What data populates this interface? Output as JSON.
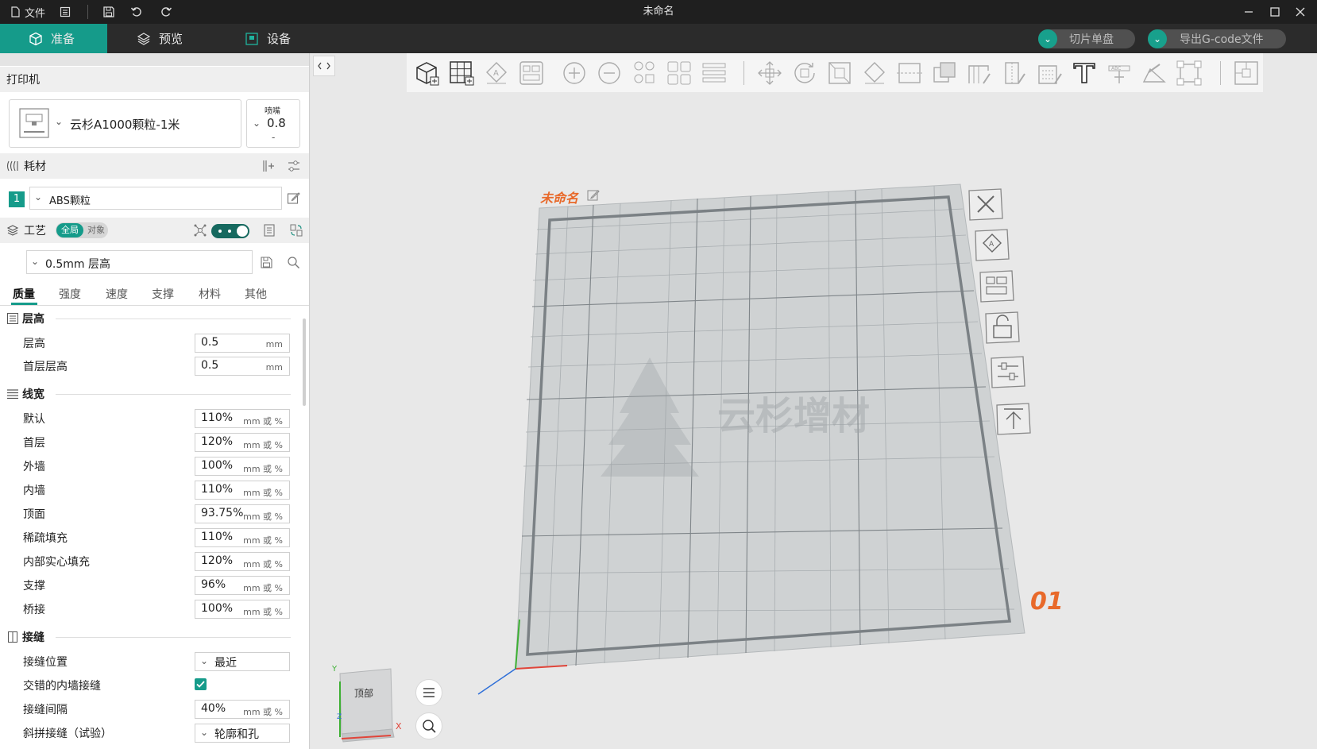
{
  "titlebar": {
    "file_menu": "文件",
    "window_title": "未命名"
  },
  "tabs": {
    "prepare": "准备",
    "preview": "预览",
    "device": "设备",
    "slice_plate": "切片单盘",
    "export_gcode": "导出G-code文件"
  },
  "printer": {
    "section_title": "打印机",
    "name": "云杉A1000颗粒-1米",
    "nozzle_label": "喷嘴",
    "nozzle_value": "0.8",
    "nozzle_sub": "-"
  },
  "filament": {
    "section_title": "耗材",
    "index": "1",
    "name": "ABS颗粒"
  },
  "process": {
    "section_title": "工艺",
    "toggle_global": "全局",
    "toggle_object": "对象",
    "preset": "0.5mm 层高",
    "tabs": [
      "质量",
      "强度",
      "速度",
      "支撑",
      "材料",
      "其他"
    ]
  },
  "groups": {
    "layer_height": "层高",
    "line_width": "线宽",
    "seam": "接缝"
  },
  "fields": {
    "layer_height": {
      "label": "层高",
      "value": "0.5",
      "unit": "mm"
    },
    "first_layer_height": {
      "label": "首层层高",
      "value": "0.5",
      "unit": "mm"
    },
    "default_width": {
      "label": "默认",
      "value": "110%",
      "unit": "mm 或 %"
    },
    "first_layer_width": {
      "label": "首层",
      "value": "120%",
      "unit": "mm 或 %"
    },
    "outer_wall": {
      "label": "外墙",
      "value": "100%",
      "unit": "mm 或 %"
    },
    "inner_wall": {
      "label": "内墙",
      "value": "110%",
      "unit": "mm 或 %"
    },
    "top_surface": {
      "label": "顶面",
      "value": "93.75%",
      "unit": "mm 或 %"
    },
    "sparse_infill": {
      "label": "稀疏填充",
      "value": "110%",
      "unit": "mm 或 %"
    },
    "internal_solid_infill": {
      "label": "内部实心填充",
      "value": "120%",
      "unit": "mm 或 %"
    },
    "support": {
      "label": "支撑",
      "value": "96%",
      "unit": "mm 或 %"
    },
    "bridge": {
      "label": "桥接",
      "value": "100%",
      "unit": "mm 或 %"
    },
    "seam_position": {
      "label": "接缝位置",
      "value": "最近"
    },
    "staggered_inner_seams": {
      "label": "交错的内墙接缝",
      "checked": true
    },
    "seam_gap": {
      "label": "接缝间隔",
      "value": "40%",
      "unit": "mm 或 %"
    },
    "scarf_seam": {
      "label": "斜拼接缝（试验）",
      "value": "轮廓和孔"
    }
  },
  "viewport": {
    "plate_name": "未命名",
    "plate_number": "01",
    "watermark": "云杉增材",
    "view_cube_label": "顶部",
    "axis_x": "X",
    "axis_y": "Y",
    "axis_z": "Z"
  },
  "colors": {
    "accent": "#159b8a",
    "plate_name": "#e8692a",
    "titlebar": "#1f1f1f",
    "tabbar": "#2b2b2b"
  }
}
